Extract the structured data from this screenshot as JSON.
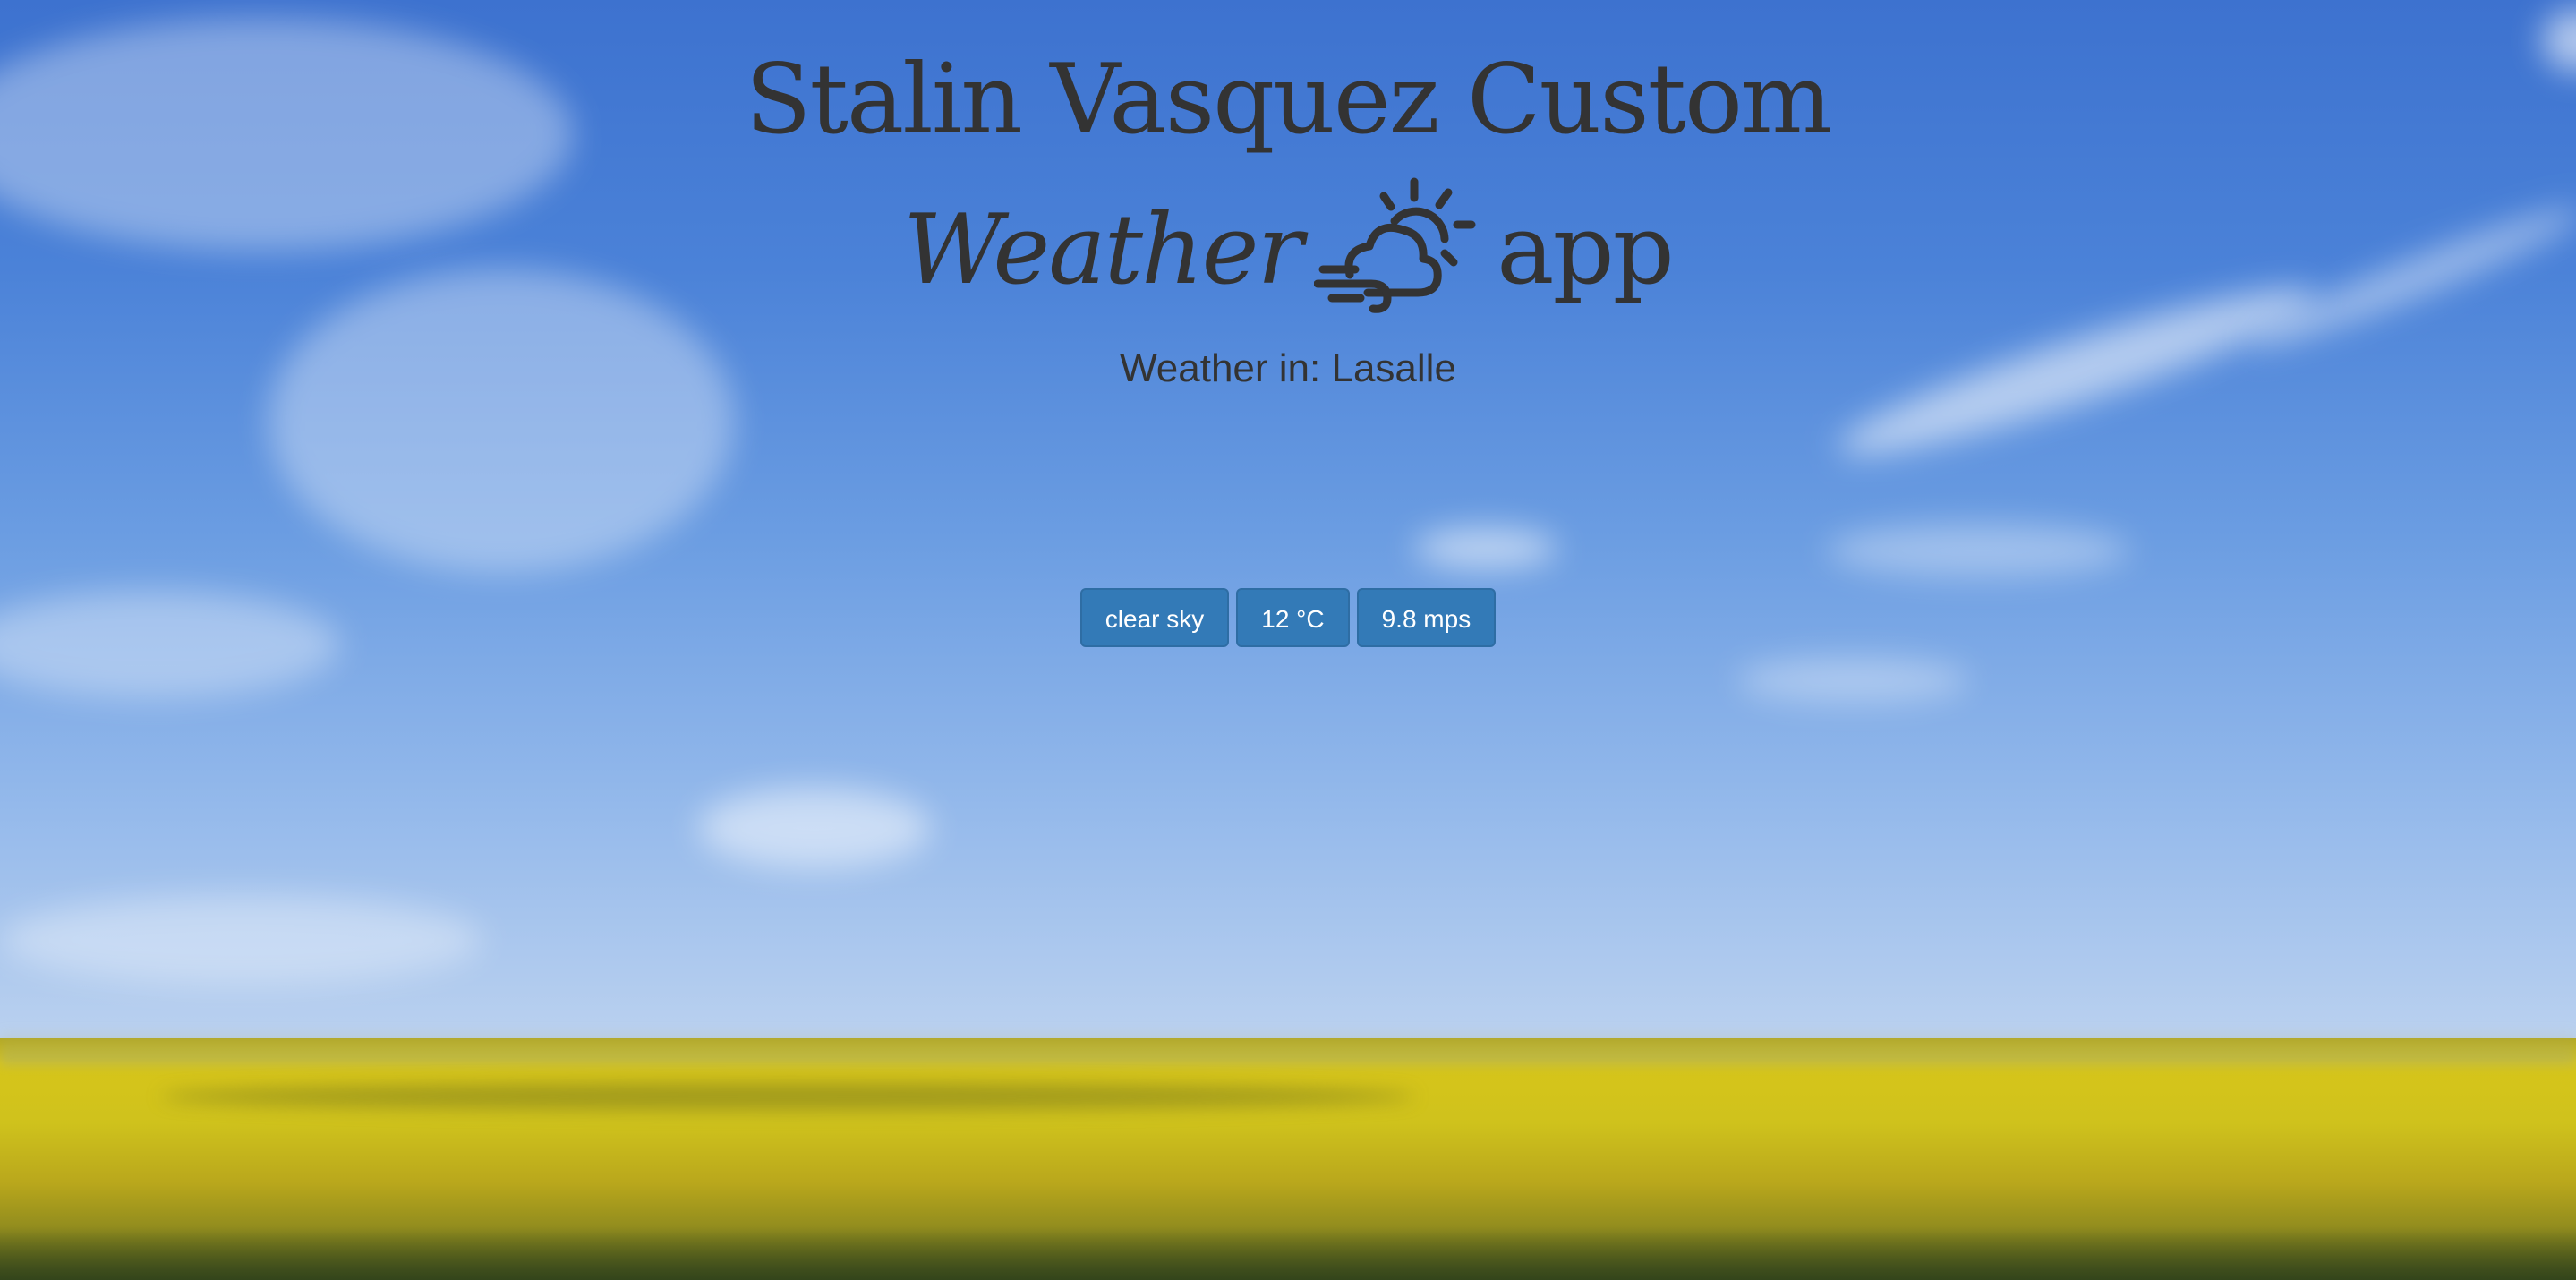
{
  "header": {
    "title_line_1": "Stalin Vasquez Custom",
    "title_word_weather": "Weather",
    "title_word_app": "app",
    "icon": "sun-behind-cloud-wind-icon"
  },
  "location": {
    "label": "Weather in: Lasalle"
  },
  "conditions": {
    "description": "clear sky",
    "temperature": "12 °C",
    "wind_speed": "9.8 mps"
  },
  "colors": {
    "text": "#333333",
    "badge_bg": "#337ab7",
    "badge_text": "#ffffff"
  }
}
